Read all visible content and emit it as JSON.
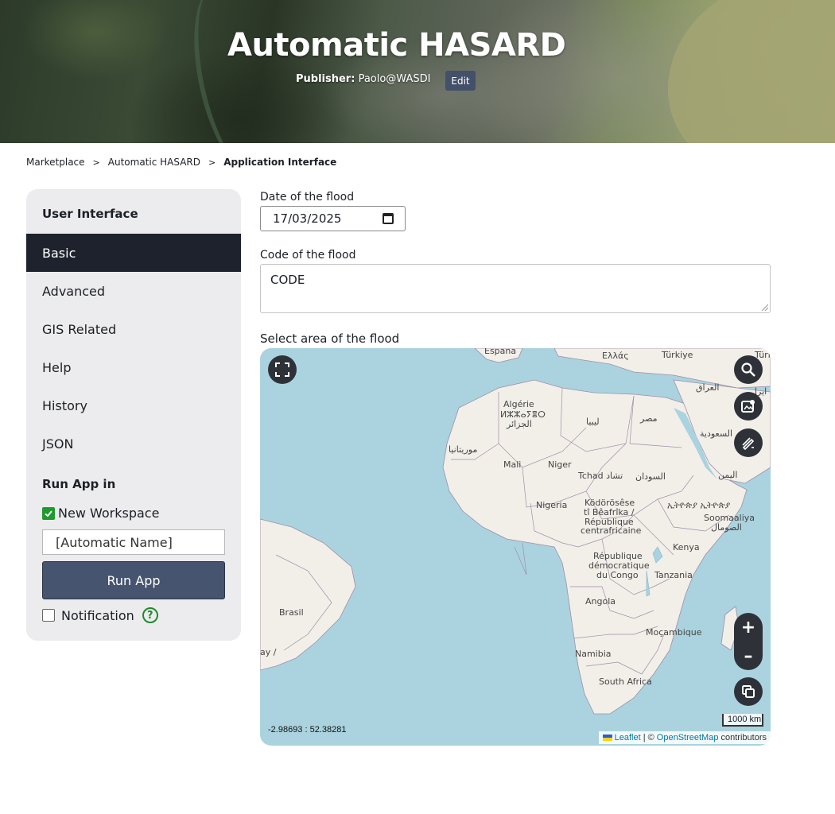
{
  "header": {
    "title": "Automatic HASARD",
    "publisher_label": "Publisher:",
    "publisher_name": "Paolo@WASDI",
    "edit_label": "Edit"
  },
  "breadcrumb": {
    "items": [
      "Marketplace",
      "Automatic HASARD",
      "Application Interface"
    ],
    "separator": ">"
  },
  "sidebar": {
    "title": "User Interface",
    "items": [
      {
        "label": "Basic",
        "active": true
      },
      {
        "label": "Advanced",
        "active": false
      },
      {
        "label": "GIS Related",
        "active": false
      },
      {
        "label": "Help",
        "active": false
      },
      {
        "label": "History",
        "active": false
      },
      {
        "label": "JSON",
        "active": false
      }
    ],
    "run_title": "Run App in",
    "new_workspace_label": "New Workspace",
    "new_workspace_checked": true,
    "workspace_name_placeholder": "[Automatic Name]",
    "run_button_label": "Run App",
    "notification_label": "Notification",
    "notification_checked": false,
    "help_icon_glyph": "?"
  },
  "form": {
    "date_label": "Date of the flood",
    "date_value": "17/03/2025",
    "code_label": "Code of the flood",
    "code_value": "CODE",
    "area_label": "Select area of the flood"
  },
  "map": {
    "labels": {
      "espana": "España",
      "greece": "Ελλάς",
      "turkiye": "Türkiye",
      "turkiye_edge": "Türk",
      "iraq": "العراق",
      "iran": "ایرا",
      "algeria1": "Algérie",
      "algeria2": "ⵍⵣⵣⴰⵢⴻⵔ",
      "algeria3": "الجزائر",
      "libya": "ليبيا",
      "egypt": "مصر",
      "saudi": "السعودية",
      "mauritania": "موريتانيا",
      "mali": "Mali",
      "niger": "Niger",
      "chad": "Tchad تشاد",
      "sudan": "السودان",
      "yemen": "اليمن",
      "nigeria": "Nigeria",
      "car1": "Ködörösêse",
      "car2": "tî Bêafrîka /",
      "car3": "République",
      "car4": "centrafricaine",
      "ethiopia": "ኢትዮጵያ ኢትዮጵያ",
      "somalia1": "Soomaaliya",
      "somalia2": "الصومال",
      "kenya": "Kenya",
      "drc1": "République",
      "drc2": "démocratique",
      "drc3": "du Congo",
      "tanzania": "Tanzania",
      "brasil": "Brasil",
      "angola": "Angola",
      "mozambique": "Moçambique",
      "namibia": "Namibia",
      "south_africa": "South Africa",
      "edge_left": "ay /"
    },
    "icons": {
      "fullscreen": "fullscreen-icon",
      "search": "search-icon",
      "screenshot": "image-export-icon",
      "draw": "draw-edit-icon",
      "layers": "layers-icon"
    },
    "zoom_in": "+",
    "zoom_out": "–",
    "coordinates": "-2.98693 : 52.38281",
    "scale": "1000 km",
    "attribution": {
      "leaflet": "Leaflet",
      "separator": "| ©",
      "osm": "OpenStreetMap",
      "suffix": "contributors"
    },
    "colors": {
      "water": "#aad3df",
      "land": "#f2efe9",
      "border": "#9e8fa6"
    }
  }
}
